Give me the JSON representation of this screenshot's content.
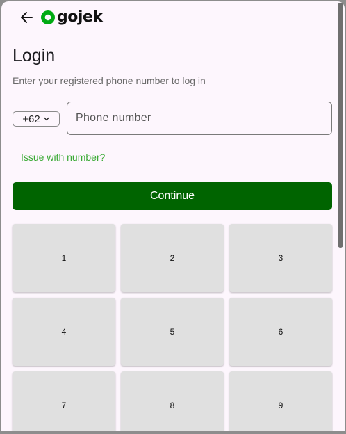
{
  "header": {
    "back_icon": "arrow-left-icon",
    "logo_text": "gojek",
    "brand_color": "#00aa13"
  },
  "login": {
    "title": "Login",
    "subtitle": "Enter your registered phone number to log in",
    "country_code": "+62",
    "phone_placeholder": "Phone number",
    "phone_value": "",
    "issue_link": "Issue with number?",
    "continue_label": "Continue",
    "continue_color": "#006400"
  },
  "keypad": {
    "keys": [
      "1",
      "2",
      "3",
      "4",
      "5",
      "6",
      "7",
      "8",
      "9"
    ]
  }
}
